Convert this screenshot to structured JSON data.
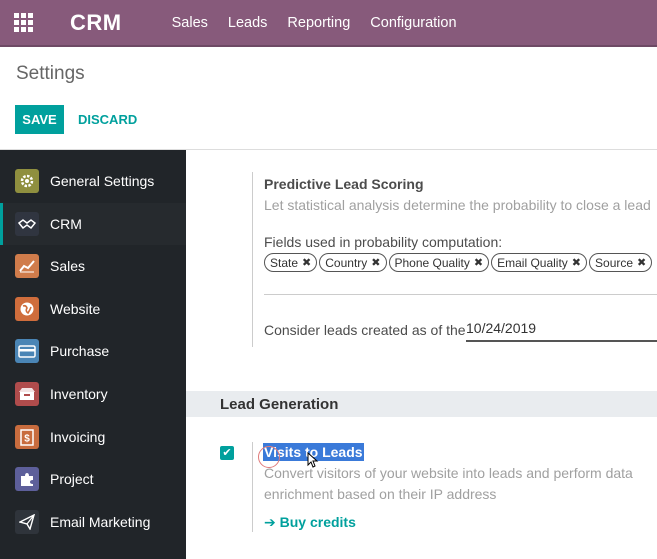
{
  "navbar": {
    "brand": "CRM",
    "menu": [
      "Sales",
      "Leads",
      "Reporting",
      "Configuration"
    ]
  },
  "control_panel": {
    "title": "Settings",
    "save_label": "SAVE",
    "discard_label": "DISCARD"
  },
  "sidebar": {
    "items": [
      {
        "label": "General Settings",
        "icon": "gear-icon",
        "color": "#8f8f3f"
      },
      {
        "label": "CRM",
        "icon": "handshake-icon",
        "color": "#303540",
        "active": true
      },
      {
        "label": "Sales",
        "icon": "chart-icon",
        "color": "#d07c4b"
      },
      {
        "label": "Website",
        "icon": "globe-icon",
        "color": "#cf6d3c"
      },
      {
        "label": "Purchase",
        "icon": "card-icon",
        "color": "#4a85b5"
      },
      {
        "label": "Inventory",
        "icon": "box-icon",
        "color": "#b04c4c"
      },
      {
        "label": "Invoicing",
        "icon": "invoice-icon",
        "color": "#c86c3e"
      },
      {
        "label": "Project",
        "icon": "puzzle-icon",
        "color": "#5d5f9a"
      },
      {
        "label": "Email Marketing",
        "icon": "paper-plane-icon",
        "color": "#2f343b"
      }
    ]
  },
  "predictive": {
    "title": "Predictive Lead Scoring",
    "description": "Let statistical analysis determine the probability to close a lead",
    "fields_label": "Fields used in probability computation:",
    "tags": [
      "State",
      "Country",
      "Phone Quality",
      "Email Quality",
      "Source"
    ],
    "date_label": "Consider leads created as of the",
    "date_value": "10/24/2019"
  },
  "lead_generation": {
    "heading": "Lead Generation",
    "visits_title": "Visits to Leads",
    "visits_description_line1": "Convert visitors of your website into leads and perform data",
    "visits_description_line2": "enrichment based on their IP address",
    "buy_credits": "Buy credits"
  }
}
